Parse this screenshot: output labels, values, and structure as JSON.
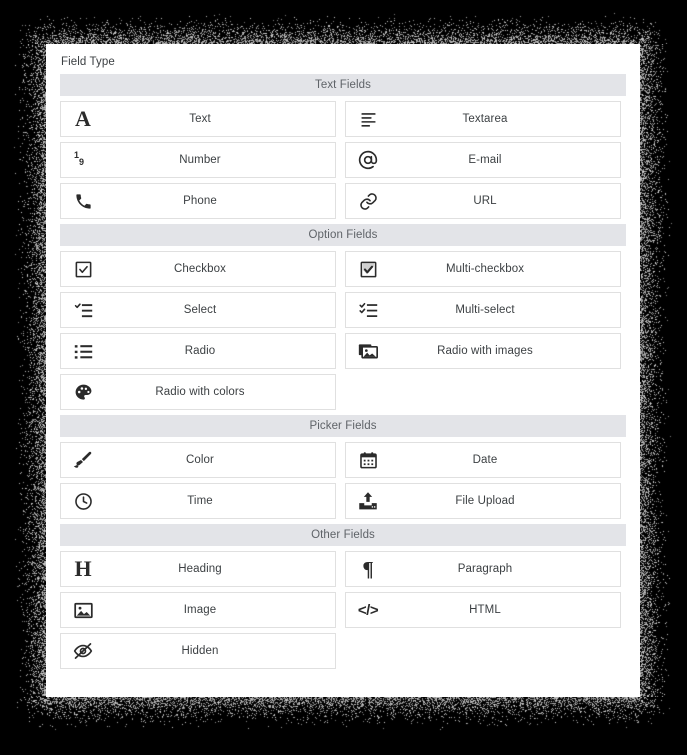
{
  "page": {
    "title": "Field Type"
  },
  "sections": [
    {
      "header": "Text Fields",
      "items": [
        {
          "label": "Text",
          "icon": "letter-a-icon"
        },
        {
          "label": "Textarea",
          "icon": "text-lines-icon"
        },
        {
          "label": "Number",
          "icon": "digits-icon"
        },
        {
          "label": "E-mail",
          "icon": "at-sign-icon"
        },
        {
          "label": "Phone",
          "icon": "phone-icon"
        },
        {
          "label": "URL",
          "icon": "link-icon"
        }
      ]
    },
    {
      "header": "Option Fields",
      "items": [
        {
          "label": "Checkbox",
          "icon": "checkbox-icon"
        },
        {
          "label": "Multi-checkbox",
          "icon": "multi-checkbox-icon"
        },
        {
          "label": "Select",
          "icon": "select-list-icon"
        },
        {
          "label": "Multi-select",
          "icon": "multi-select-list-icon"
        },
        {
          "label": "Radio",
          "icon": "bullet-list-icon"
        },
        {
          "label": "Radio with images",
          "icon": "images-icon"
        },
        {
          "label": "Radio with colors",
          "icon": "palette-icon"
        }
      ]
    },
    {
      "header": "Picker Fields",
      "items": [
        {
          "label": "Color",
          "icon": "paintbrush-icon"
        },
        {
          "label": "Date",
          "icon": "calendar-icon"
        },
        {
          "label": "Time",
          "icon": "clock-icon"
        },
        {
          "label": "File Upload",
          "icon": "upload-icon"
        }
      ]
    },
    {
      "header": "Other Fields",
      "items": [
        {
          "label": "Heading",
          "icon": "heading-h-icon"
        },
        {
          "label": "Paragraph",
          "icon": "pilcrow-icon"
        },
        {
          "label": "Image",
          "icon": "image-icon"
        },
        {
          "label": "HTML",
          "icon": "code-tags-icon"
        },
        {
          "label": "Hidden",
          "icon": "eye-slash-icon"
        }
      ]
    }
  ],
  "colors": {
    "panel_background": "#ffffff",
    "section_header_background": "#e3e4e8",
    "card_border": "#e0e0e0",
    "text": "#3c4043",
    "backdrop": "#000000"
  }
}
